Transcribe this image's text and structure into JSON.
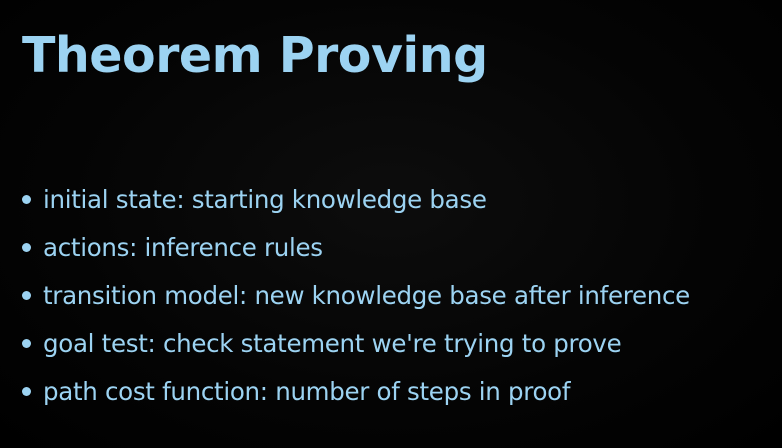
{
  "slide": {
    "title": "Theorem Proving",
    "bullets": [
      "initial state: starting knowledge base",
      "actions: inference rules",
      "transition model: new knowledge base after inference",
      "goal test: check statement we're trying to prove",
      "path cost function: number of steps in proof"
    ],
    "colors": {
      "background": "#000000",
      "text": "#9cd3f2"
    }
  }
}
